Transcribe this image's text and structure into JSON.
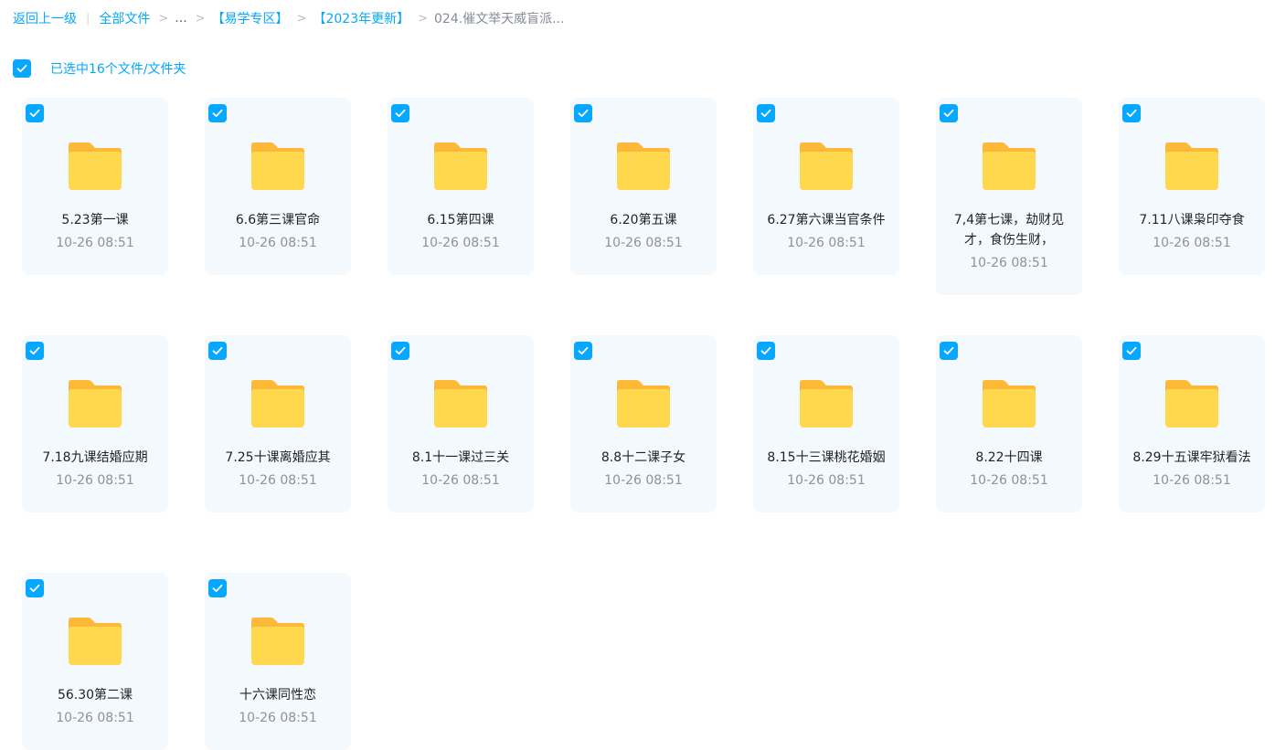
{
  "breadcrumb": {
    "back": "返回上一级",
    "all_files": "全部文件",
    "ellipsis": "...",
    "crumbs": [
      "【易学专区】",
      "【2023年更新】"
    ],
    "current": "024.催文举天威盲派..."
  },
  "selection": {
    "label": "已选中16个文件/文件夹",
    "checked": true
  },
  "colors": {
    "accent": "#06a7ff",
    "card_bg": "#f3f9fd",
    "folder_top": "#ffb938",
    "folder_body": "#ffd84e"
  },
  "icons": {
    "folder": "folder-icon",
    "check": "checkmark-icon"
  },
  "files": [
    {
      "name": "5.23第一课",
      "time": "10-26 08:51",
      "selected": true
    },
    {
      "name": "6.6第三课官命",
      "time": "10-26 08:51",
      "selected": true
    },
    {
      "name": "6.15第四课",
      "time": "10-26 08:51",
      "selected": true
    },
    {
      "name": "6.20第五课",
      "time": "10-26 08:51",
      "selected": true
    },
    {
      "name": "6.27第六课当官条件",
      "time": "10-26 08:51",
      "selected": true
    },
    {
      "name": "7,4第七课，劫财见才，食伤生财，",
      "time": "10-26 08:51",
      "selected": true
    },
    {
      "name": "7.11八课枭印夺食",
      "time": "10-26 08:51",
      "selected": true
    },
    {
      "name": "7.18九课结婚应期",
      "time": "10-26 08:51",
      "selected": true
    },
    {
      "name": "7.25十课离婚应其",
      "time": "10-26 08:51",
      "selected": true
    },
    {
      "name": "8.1十一课过三关",
      "time": "10-26 08:51",
      "selected": true
    },
    {
      "name": "8.8十二课子女",
      "time": "10-26 08:51",
      "selected": true
    },
    {
      "name": "8.15十三课桃花婚姻",
      "time": "10-26 08:51",
      "selected": true
    },
    {
      "name": "8.22十四课",
      "time": "10-26 08:51",
      "selected": true
    },
    {
      "name": "8.29十五课牢狱看法",
      "time": "10-26 08:51",
      "selected": true
    },
    {
      "name": "56.30第二课",
      "time": "10-26 08:51",
      "selected": true
    },
    {
      "name": "十六课同性恋",
      "time": "10-26 08:51",
      "selected": true
    }
  ]
}
